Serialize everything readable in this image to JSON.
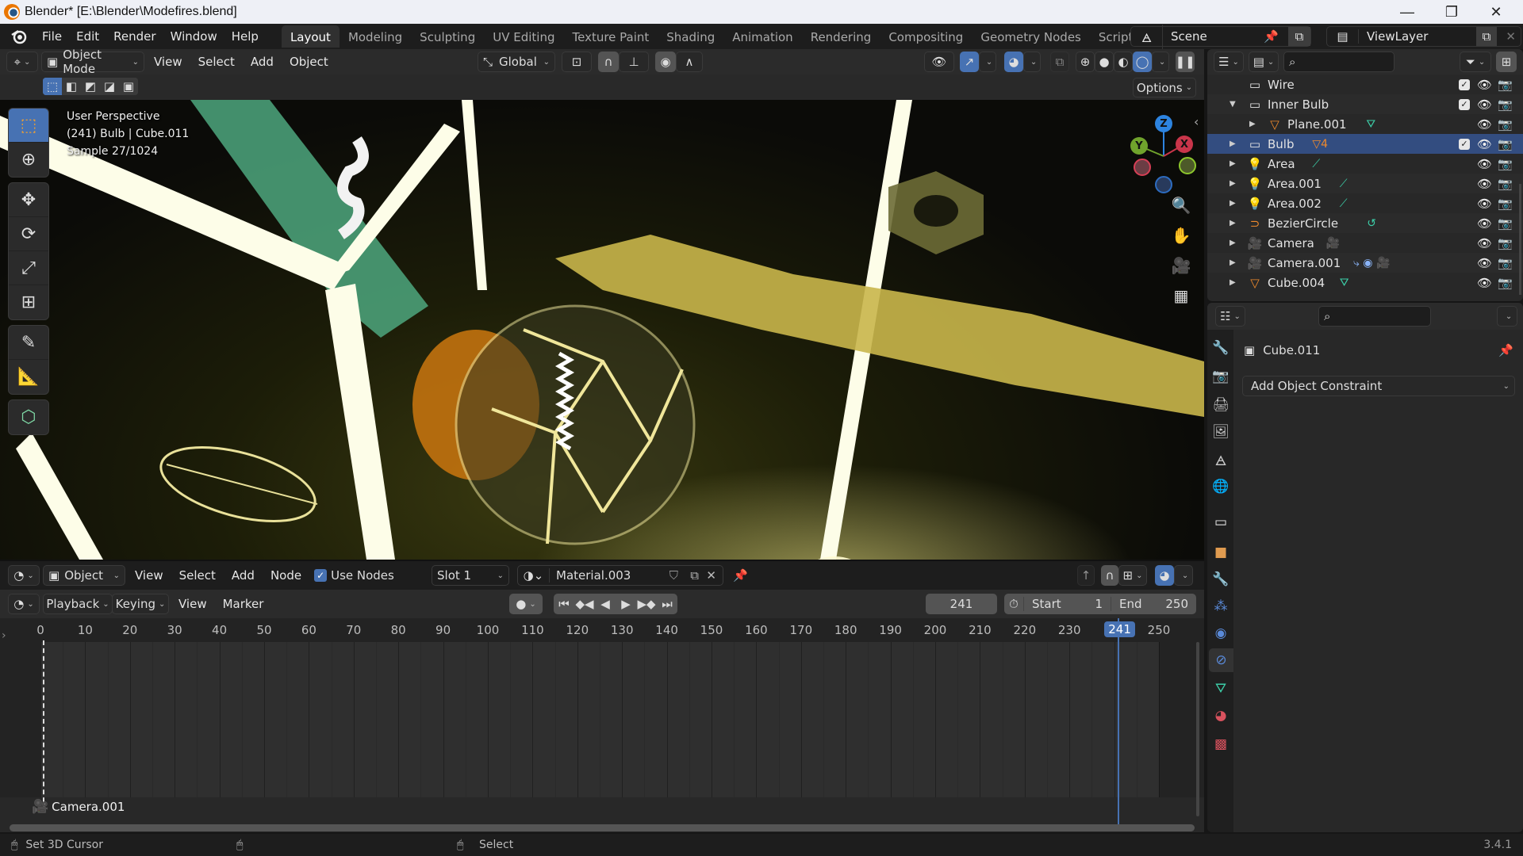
{
  "window": {
    "title": "Blender* [E:\\Blender\\Modefires.blend]",
    "controls": {
      "minimize": "—",
      "maximize": "❐",
      "close": "✕"
    }
  },
  "topbar": {
    "menus": [
      "File",
      "Edit",
      "Render",
      "Window",
      "Help"
    ],
    "workspaces": [
      "Layout",
      "Modeling",
      "Sculpting",
      "UV Editing",
      "Texture Paint",
      "Shading",
      "Animation",
      "Rendering",
      "Compositing",
      "Geometry Nodes",
      "Scripting"
    ],
    "active_workspace": "Layout",
    "add_workspace": "+",
    "scene": "Scene",
    "view_layer": "ViewLayer"
  },
  "viewport": {
    "mode": "Object Mode",
    "menus": [
      "View",
      "Select",
      "Add",
      "Object"
    ],
    "transform_orientation": "Global",
    "options_label": "Options",
    "overlay_lines": [
      "User Perspective",
      "(241) Bulb | Cube.011",
      "Sample 27/1024"
    ],
    "gizmo_axes": {
      "z": "Z",
      "y": "Y",
      "x": "X"
    },
    "tools": [
      "select-box",
      "cursor",
      "move",
      "rotate",
      "scale",
      "transform",
      "annotate",
      "measure",
      "add-cube"
    ],
    "colors": {
      "accent": "#4772b3",
      "x_axis": "#c9354a",
      "y_axis": "#70a32c",
      "z_axis": "#2d84e0"
    }
  },
  "node_editor": {
    "type": "Object",
    "menus": [
      "View",
      "Select",
      "Add",
      "Node"
    ],
    "use_nodes_label": "Use Nodes",
    "use_nodes_checked": true,
    "slot": "Slot 1",
    "material": "Material.003"
  },
  "timeline": {
    "menus": [
      "Playback",
      "Keying",
      "View",
      "Marker"
    ],
    "current_frame": "241",
    "start_label": "Start",
    "start": "1",
    "end_label": "End",
    "end": "250",
    "ruler_ticks": [
      "0",
      "10",
      "20",
      "30",
      "40",
      "50",
      "60",
      "70",
      "80",
      "90",
      "100",
      "110",
      "120",
      "130",
      "140",
      "150",
      "160",
      "170",
      "180",
      "190",
      "200",
      "210",
      "220",
      "230",
      "250"
    ],
    "cursor_badge": "241",
    "marker_label": "Camera.001"
  },
  "outliner": {
    "rows": [
      {
        "name": "Wire",
        "icon": "collection",
        "expand": "",
        "check": true,
        "data": ""
      },
      {
        "name": "Inner Bulb",
        "icon": "collection",
        "expand": "▼",
        "check": true,
        "data": ""
      },
      {
        "name": "Plane.001",
        "icon": "mesh",
        "expand": "▶",
        "check": false,
        "data": "mesh-data",
        "indent": true
      },
      {
        "name": "Bulb",
        "icon": "collection",
        "expand": "▶",
        "check": true,
        "data": "mesh-count",
        "count": "4",
        "selected": true
      },
      {
        "name": "Area",
        "icon": "light",
        "expand": "▶",
        "check": false,
        "data": "light-data"
      },
      {
        "name": "Area.001",
        "icon": "light",
        "expand": "▶",
        "check": false,
        "data": "light-data"
      },
      {
        "name": "Area.002",
        "icon": "light",
        "expand": "▶",
        "check": false,
        "data": "light-data"
      },
      {
        "name": "BezierCircle",
        "icon": "curve",
        "expand": "▶",
        "check": false,
        "data": "curve-data"
      },
      {
        "name": "Camera",
        "icon": "camera",
        "expand": "▶",
        "check": false,
        "data": "camera-data"
      },
      {
        "name": "Camera.001",
        "icon": "camera",
        "expand": "▶",
        "check": false,
        "data": "camera-constraint"
      },
      {
        "name": "Cube.004",
        "icon": "mesh",
        "expand": "▶",
        "check": false,
        "data": "mesh-data"
      }
    ]
  },
  "properties": {
    "object_name": "Cube.011",
    "add_constraint_label": "Add Object Constraint",
    "tabs": [
      "tool",
      "render",
      "output",
      "view-layer",
      "scene",
      "world",
      "collection",
      "object",
      "modifiers",
      "particles",
      "physics",
      "constraints",
      "data",
      "material",
      "texture"
    ],
    "active_tab": "constraints"
  },
  "statusbar": {
    "left_action": "Set 3D Cursor",
    "right_action": "Select",
    "version": "3.4.1"
  }
}
